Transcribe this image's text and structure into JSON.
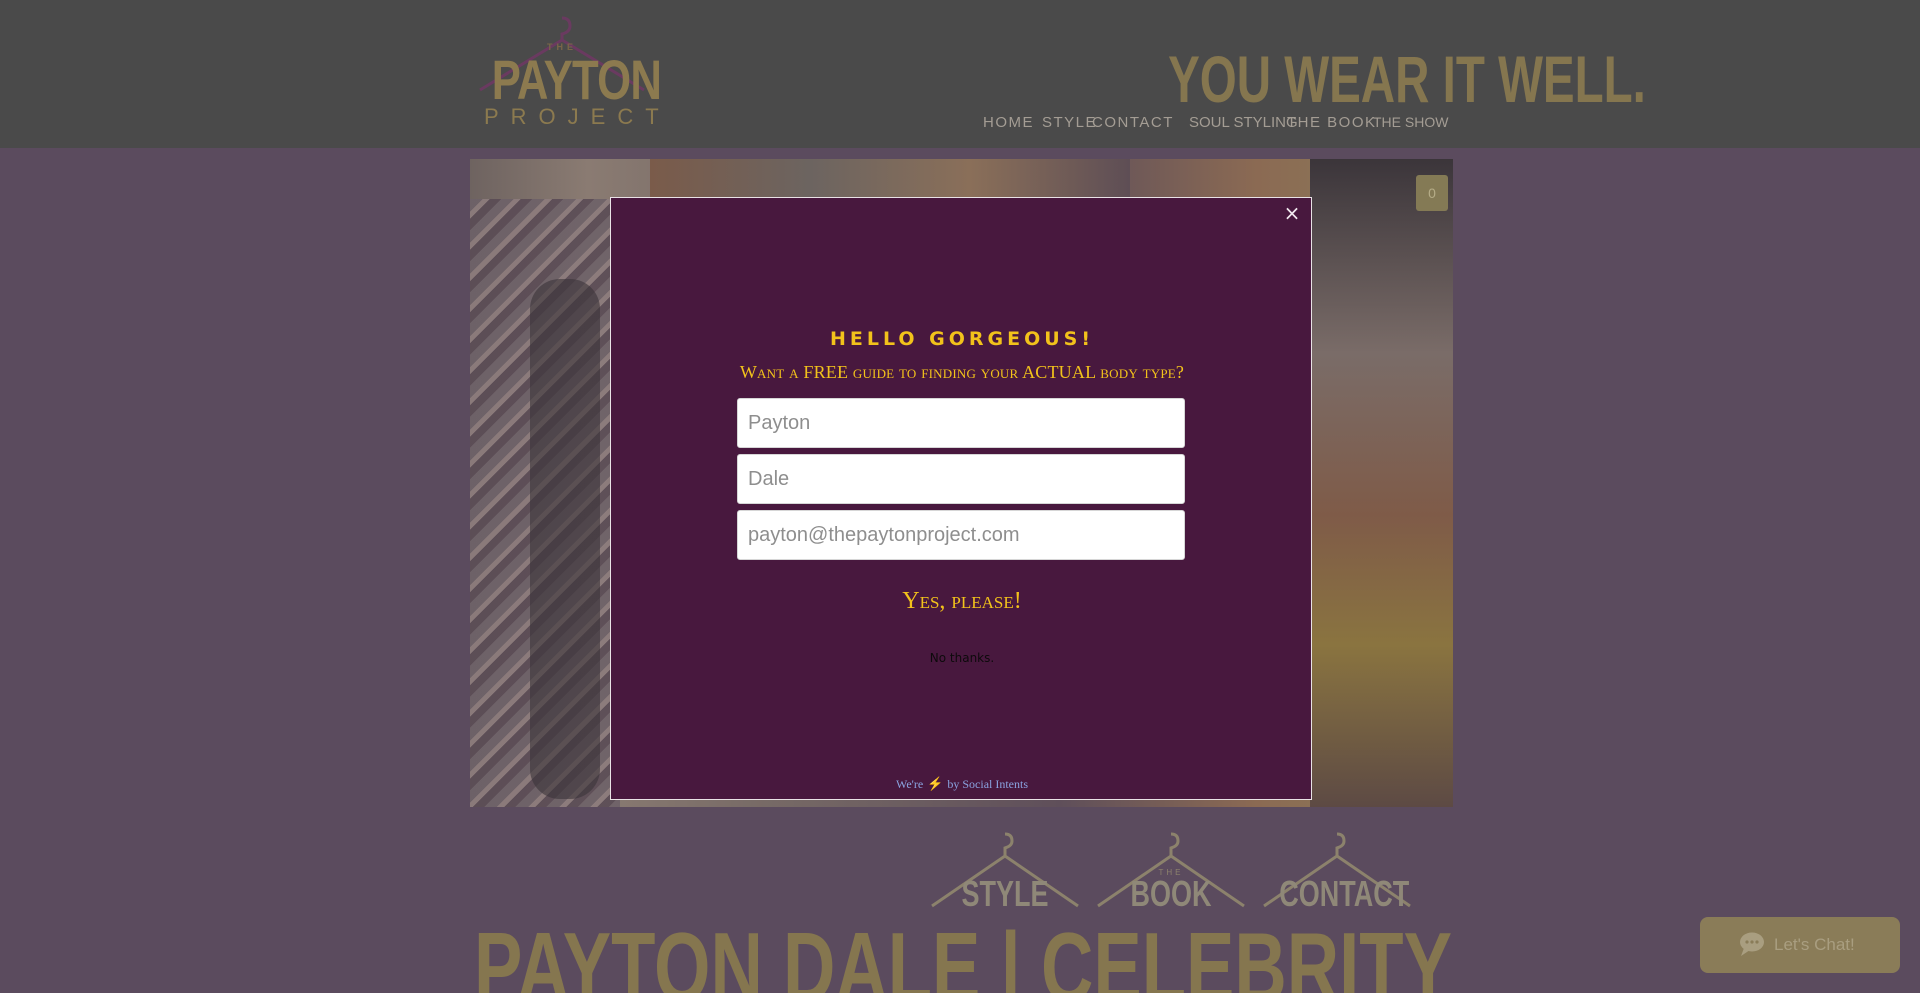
{
  "header": {
    "logo": {
      "the": "THE",
      "main": "PAYTON",
      "sub": "PROJECT"
    },
    "tagline": "YOU WEAR IT WELL.",
    "nav": [
      "HOME",
      "STYLE",
      "CONTACT",
      "SOUL STYLING",
      "THE BOOK",
      "THE SHOW"
    ]
  },
  "hero": {
    "cart_count": "0"
  },
  "lower": {
    "hangers": [
      {
        "small": "",
        "label": "STYLE"
      },
      {
        "small": "THE",
        "label": "BOOK"
      },
      {
        "small": "",
        "label": "CONTACT"
      }
    ],
    "big_title": "PAYTON DALE | CELEBRITY STYLIST"
  },
  "chat": {
    "label": "Let's Chat!"
  },
  "modal": {
    "close": "×",
    "heading": "HELLO GORGEOUS!",
    "subheading": "Want a FREE guide to finding your ACTUAL body type?",
    "first_name_placeholder": "Payton",
    "last_name_placeholder": "Dale",
    "email_placeholder": "payton@thepaytonproject.com",
    "submit": "Yes, please!",
    "decline": "No thanks.",
    "powered": {
      "prefix": "We're",
      "bolt": "⚡",
      "suffix": "by Social Intents"
    }
  },
  "colors": {
    "modal_bg": "#48183e",
    "accent_gold": "#f2c21b",
    "header_bg": "#4a4a4a",
    "page_bg": "#5b4b5e"
  }
}
